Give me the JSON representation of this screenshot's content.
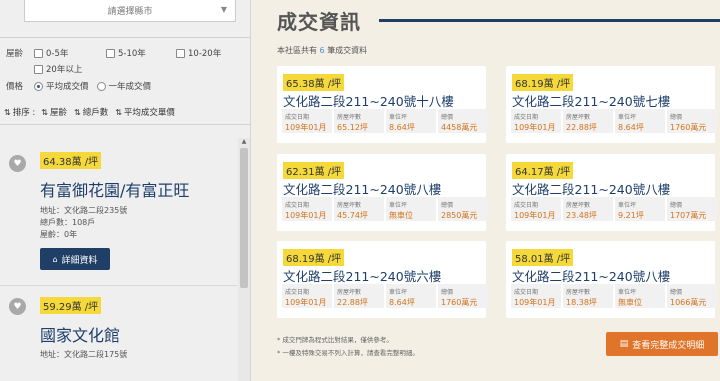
{
  "left": {
    "city_select": {
      "placeholder": "請選擇縣市"
    },
    "filters": {
      "age_label": "屋齡",
      "age_options": [
        "0-5年",
        "5-10年",
        "10-20年",
        "20年以上"
      ],
      "price_label": "價格",
      "price_options": [
        "平均成交價",
        "一年成交價"
      ]
    },
    "sort": {
      "label": "排序 :",
      "items": [
        "屋齡",
        "總戶數",
        "平均成交單價"
      ]
    },
    "listings": [
      {
        "price": "64.38萬 /坪",
        "title": "有富御花園/有富正旺",
        "address": "地址：文化路二段235號",
        "households": "總戶數：108戶",
        "age": "屋齡：0年",
        "button": "詳細資料"
      },
      {
        "price": "59.29萬 /坪",
        "title": "國家文化館",
        "address": "地址：文化路二段175號"
      }
    ]
  },
  "right": {
    "title": "成交資訊",
    "subtitle_prefix": "本社區共有",
    "subtitle_count": "6",
    "subtitle_suffix": "筆成交資料",
    "column_headers": [
      "成交日期",
      "房屋坪數",
      "車位坪",
      "總價"
    ],
    "cards": [
      {
        "price": "65.38萬 /坪",
        "address": "文化路二段211~240號十八樓",
        "date": "109年01月",
        "area": "65.12坪",
        "parking": "8.64坪",
        "total": "4458萬元"
      },
      {
        "price": "68.19萬 /坪",
        "address": "文化路二段211~240號七樓",
        "date": "109年01月",
        "area": "22.88坪",
        "parking": "8.64坪",
        "total": "1760萬元"
      },
      {
        "price": "62.31萬 /坪",
        "address": "文化路二段211~240號八樓",
        "date": "109年01月",
        "area": "45.74坪",
        "parking": "無車位",
        "total": "2850萬元"
      },
      {
        "price": "64.17萬 /坪",
        "address": "文化路二段211~240號八樓",
        "date": "109年01月",
        "area": "23.48坪",
        "parking": "9.21坪",
        "total": "1707萬元"
      },
      {
        "price": "68.19萬 /坪",
        "address": "文化路二段211~240號六樓",
        "date": "109年01月",
        "area": "22.88坪",
        "parking": "8.64坪",
        "total": "1760萬元"
      },
      {
        "price": "58.01萬 /坪",
        "address": "文化路二段211~240號八樓",
        "date": "109年01月",
        "area": "18.38坪",
        "parking": "無車位",
        "total": "1066萬元"
      }
    ],
    "notes": [
      "* 成交門牌為程式比對結果，僅供參考。",
      "* 一樓及特殊交易不列入計算，請查看完整明細。"
    ],
    "full_button": "查看完整成交明細"
  },
  "colors": {
    "accent_navy": "#1f3f66",
    "price_yellow": "#f5d93a",
    "value_orange": "#d2741e",
    "button_orange": "#e0742a"
  }
}
